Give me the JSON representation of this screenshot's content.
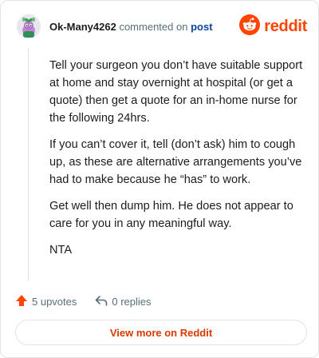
{
  "comment": {
    "username": "Ok-Many4262",
    "action_text": "commented on",
    "target_link": "post",
    "paragraphs": [
      "Tell your surgeon you don’t have suitable support at home and stay overnight at hospital (or get a quote) then get a quote for an in-home nurse for the following 24hrs.",
      "If you can’t cover it, tell (don’t ask) him to cough up, as these are alternative arrangements you’ve had to make because he “has” to work.",
      "Get well then dump him. He does not appear to care for you in any meaningful way.",
      "NTA"
    ]
  },
  "brand": {
    "name": "reddit",
    "color": "#ff4500"
  },
  "actions": {
    "upvotes": "5 upvotes",
    "replies": "0 replies"
  },
  "footer": {
    "view_more": "View more on Reddit"
  },
  "icons": [
    "avatar",
    "reddit-logo-icon",
    "upvote-icon",
    "reply-icon"
  ]
}
